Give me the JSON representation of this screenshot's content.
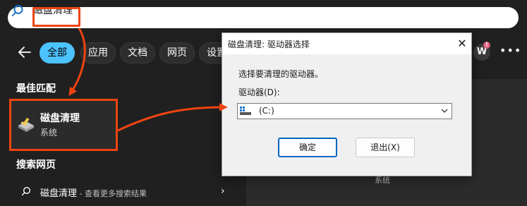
{
  "search": {
    "query": "磁盘清理"
  },
  "filters": {
    "items": [
      {
        "label": "全部",
        "active": true
      },
      {
        "label": "应用",
        "active": false
      },
      {
        "label": "文档",
        "active": false
      },
      {
        "label": "网页",
        "active": false
      },
      {
        "label": "设置",
        "active": false
      }
    ]
  },
  "account": {
    "avatar_letter": "W",
    "badge": "!"
  },
  "sections": {
    "best_match_title": "最佳匹配",
    "web_title": "搜索网页"
  },
  "best_match": {
    "title": "磁盘清理",
    "subtitle": "系统"
  },
  "web_result": {
    "query": "磁盘清理",
    "hint": " - 查看更多搜索结果"
  },
  "preview": {
    "subtitle": "系统"
  },
  "dialog": {
    "title": "磁盘清理: 驱动器选择",
    "prompt": "选择要清理的驱动器。",
    "drive_label": "驱动器(D):",
    "selected_drive": "(C:)",
    "ok_label": "确定",
    "cancel_label": "退出(X)"
  },
  "colors": {
    "accent": "#4cc2ff",
    "annotation": "#ee4411",
    "background": "#202020"
  },
  "icons": [
    "search-icon",
    "back-arrow-icon",
    "more-icon",
    "disk-cleanup-icon",
    "drive-icon",
    "chevron-down-icon",
    "chevron-right-icon",
    "close-icon"
  ]
}
